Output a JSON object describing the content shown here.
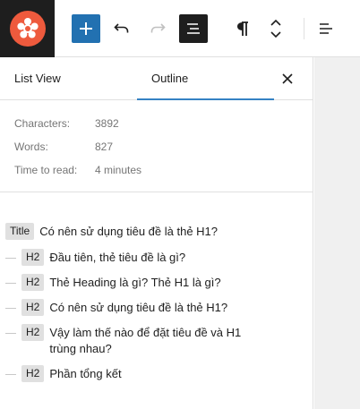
{
  "toolbar": {
    "logo_icon": "flower-logo-icon",
    "buttons": [
      {
        "name": "add-block",
        "icon": "plus-icon"
      },
      {
        "name": "undo",
        "icon": "undo-icon"
      },
      {
        "name": "redo",
        "icon": "redo-icon"
      },
      {
        "name": "document-overview",
        "icon": "list-view-icon"
      },
      {
        "name": "paragraph",
        "icon": "pilcrow-icon"
      },
      {
        "name": "move",
        "icon": "chevron-up-down-icon"
      },
      {
        "name": "align",
        "icon": "align-icon"
      }
    ],
    "accent_color": "#2271b1"
  },
  "panel": {
    "tabs": [
      {
        "label": "List View",
        "active": false
      },
      {
        "label": "Outline",
        "active": true
      }
    ],
    "stats": [
      {
        "label": "Characters:",
        "value": "3892"
      },
      {
        "label": "Words:",
        "value": "827"
      },
      {
        "label": "Time to read:",
        "value": "4 minutes"
      }
    ],
    "outline": [
      {
        "tag": "Title",
        "text": "Có nên sử dụng tiêu đề là thẻ H1?"
      },
      {
        "tag": "H2",
        "text": "Đầu tiên, thẻ tiêu đề là gì?"
      },
      {
        "tag": "H2",
        "text": "Thẻ Heading là gì? Thẻ H1 là gì?"
      },
      {
        "tag": "H2",
        "text": "Có nên sử dụng tiêu đề là thẻ H1?"
      },
      {
        "tag": "H2",
        "text": "Vậy làm thế nào để đặt tiêu đề và H1 trùng nhau?"
      },
      {
        "tag": "H2",
        "text": "Phần tổng kết"
      }
    ]
  }
}
